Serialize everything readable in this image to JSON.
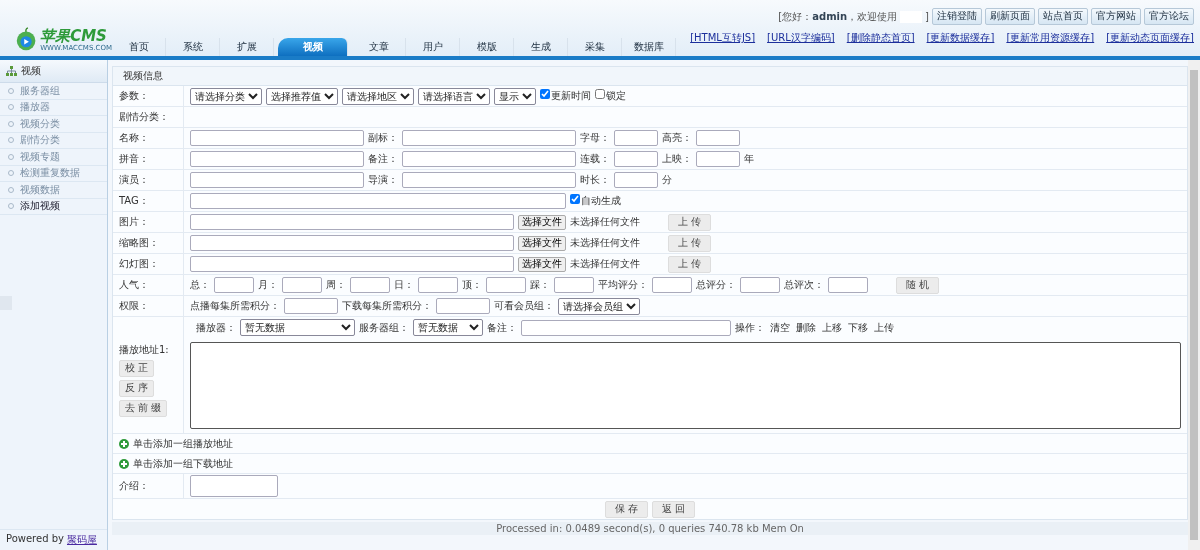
{
  "header": {
    "logo_text": "苹果CMS",
    "logo_subtext": "WWW.MACCMS.COM",
    "greeting": "[您好：**admin**，欢迎使用",
    "greeting_end": "]",
    "top_buttons": [
      "注销登陆",
      "刷新页面",
      "站点首页",
      "官方网站",
      "官方论坛"
    ],
    "quick_links": [
      "[HTML互转JS]",
      "[URL汉字编码]",
      "[删除静态首页]",
      "[更新数据缓存]",
      "[更新常用资源缓存]",
      "[更新动态页面缓存]"
    ]
  },
  "tabs": [
    {
      "label": "首页",
      "selected": false
    },
    {
      "label": "系统",
      "selected": false
    },
    {
      "label": "扩展",
      "selected": false
    },
    {
      "label": "视频",
      "selected": true
    },
    {
      "label": "文章",
      "selected": false
    },
    {
      "label": "用户",
      "selected": false
    },
    {
      "label": "模版",
      "selected": false
    },
    {
      "label": "生成",
      "selected": false
    },
    {
      "label": "采集",
      "selected": false
    },
    {
      "label": "数据库",
      "selected": false
    }
  ],
  "sidebar": {
    "title": "视频",
    "items": [
      {
        "label": "服务器组",
        "selected": false
      },
      {
        "label": "播放器",
        "selected": false
      },
      {
        "label": "视频分类",
        "selected": false
      },
      {
        "label": "剧情分类",
        "selected": false
      },
      {
        "label": "视频专题",
        "selected": false
      },
      {
        "label": "检测重复数据",
        "selected": false
      },
      {
        "label": "视频数据",
        "selected": false
      },
      {
        "label": "添加视频",
        "selected": true
      }
    ],
    "powered_by": "Powered by",
    "powered_link": "聚码屋"
  },
  "form": {
    "title": "视频信息",
    "rows": [
      {
        "label": "参数：",
        "controls": [
          {
            "kind": "select",
            "value": "请选择分类"
          },
          {
            "kind": "select",
            "value": "选择推荐值"
          },
          {
            "kind": "select",
            "value": "请选择地区"
          },
          {
            "kind": "select",
            "value": "请选择语言"
          },
          {
            "kind": "select",
            "value": "显示"
          },
          {
            "kind": "checkbox",
            "label": "更新时间",
            "checked": true
          },
          {
            "kind": "checkbox",
            "label": "锁定",
            "checked": false
          }
        ]
      },
      {
        "label": "剧情分类：",
        "controls": []
      },
      {
        "label": "名称：",
        "controls": [
          {
            "kind": "linput"
          },
          {
            "kind": "text",
            "text": "副标："
          },
          {
            "kind": "linput"
          },
          {
            "kind": "text",
            "text": "字母："
          },
          {
            "kind": "sinput"
          },
          {
            "kind": "text",
            "text": "高亮："
          },
          {
            "kind": "sinput"
          }
        ]
      },
      {
        "label": "拼音：",
        "controls": [
          {
            "kind": "linput"
          },
          {
            "kind": "text",
            "text": "备注："
          },
          {
            "kind": "linput"
          },
          {
            "kind": "text",
            "text": "连载："
          },
          {
            "kind": "sinput"
          },
          {
            "kind": "text",
            "text": "上映："
          },
          {
            "kind": "sinput"
          },
          {
            "kind": "text",
            "text": "年"
          }
        ]
      },
      {
        "label": "演员：",
        "controls": [
          {
            "kind": "linput"
          },
          {
            "kind": "text",
            "text": "导演："
          },
          {
            "kind": "linput"
          },
          {
            "kind": "text",
            "text": "时长："
          },
          {
            "kind": "sinput"
          },
          {
            "kind": "text",
            "text": "分"
          }
        ]
      },
      {
        "label": "TAG：",
        "controls": [
          {
            "kind": "xxlinput"
          },
          {
            "kind": "checkbox",
            "label": "自动生成",
            "checked": true
          }
        ]
      },
      {
        "label": "图片：",
        "controls": [
          {
            "kind": "xlinput"
          },
          {
            "kind": "file",
            "button": "选择文件",
            "status": "未选择任何文件"
          },
          {
            "kind": "button",
            "label": "上 传"
          }
        ]
      },
      {
        "label": "缩略图：",
        "controls": [
          {
            "kind": "xlinput"
          },
          {
            "kind": "file",
            "button": "选择文件",
            "status": "未选择任何文件"
          },
          {
            "kind": "button",
            "label": "上 传"
          }
        ]
      },
      {
        "label": "幻灯图：",
        "controls": [
          {
            "kind": "xlinput"
          },
          {
            "kind": "file",
            "button": "选择文件",
            "status": "未选择任何文件"
          },
          {
            "kind": "button",
            "label": "上 传"
          }
        ]
      },
      {
        "label": "人气：",
        "controls": [
          {
            "kind": "text",
            "text": "总："
          },
          {
            "kind": "xsinput"
          },
          {
            "kind": "text",
            "text": "月："
          },
          {
            "kind": "xsinput"
          },
          {
            "kind": "text",
            "text": "周："
          },
          {
            "kind": "xsinput"
          },
          {
            "kind": "text",
            "text": "日："
          },
          {
            "kind": "xsinput"
          },
          {
            "kind": "text",
            "text": "顶："
          },
          {
            "kind": "xsinput"
          },
          {
            "kind": "text",
            "text": "踩："
          },
          {
            "kind": "xsinput"
          },
          {
            "kind": "text",
            "text": "平均评分："
          },
          {
            "kind": "xsinput"
          },
          {
            "kind": "text",
            "text": "总评分："
          },
          {
            "kind": "xsinput"
          },
          {
            "kind": "text",
            "text": "总评次："
          },
          {
            "kind": "xsinput"
          },
          {
            "kind": "button",
            "label": "随 机"
          }
        ]
      },
      {
        "label": "权限：",
        "controls": [
          {
            "kind": "text",
            "text": "点播每集所需积分："
          },
          {
            "kind": "minput"
          },
          {
            "kind": "text",
            "text": "下载每集所需积分："
          },
          {
            "kind": "minput"
          },
          {
            "kind": "text",
            "text": "可看会员组："
          },
          {
            "kind": "select",
            "value": "请选择会员组"
          }
        ]
      }
    ],
    "playlist": {
      "label": "播放地址1:",
      "side_buttons": [
        "校 正",
        "反 序",
        "去 前 缀"
      ],
      "controls": [
        {
          "kind": "text",
          "text": "播放器："
        },
        {
          "kind": "lselect",
          "value": "暂无数据"
        },
        {
          "kind": "text",
          "text": "服务器组："
        },
        {
          "kind": "mselect",
          "value": "暂无数据"
        },
        {
          "kind": "text",
          "text": "备注："
        },
        {
          "kind": "noteinput"
        },
        {
          "kind": "text",
          "text": "操作："
        },
        {
          "kind": "action",
          "label": "清空"
        },
        {
          "kind": "action",
          "label": "删除"
        },
        {
          "kind": "action",
          "label": "上移"
        },
        {
          "kind": "action",
          "label": "下移"
        },
        {
          "kind": "action",
          "label": "上传"
        }
      ]
    },
    "add_links": [
      "单击添加一组播放地址",
      "单击添加一组下载地址"
    ],
    "intro": {
      "label": "介绍："
    },
    "actions": [
      "保 存",
      "返 回"
    ]
  },
  "footer": "Processed in: 0.0489 second(s), 0 queries 740.78 kb Mem On"
}
